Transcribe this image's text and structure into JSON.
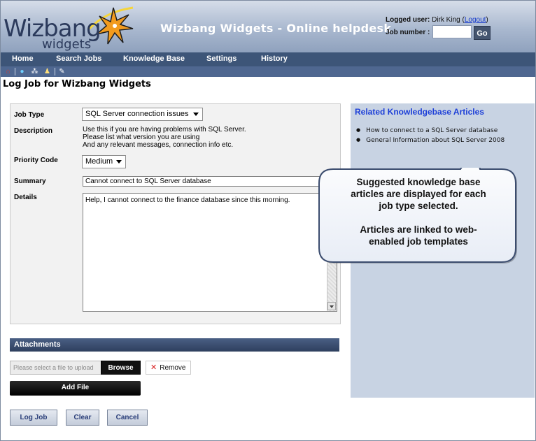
{
  "header": {
    "logo_word": "Wizbang",
    "logo_sub": "widgets",
    "title": "Wizbang Widgets - Online helpdesk",
    "logged_user_label": "Logged user:",
    "logged_user_name": "Dirk King",
    "logout_open": "(",
    "logout_label": "Logout",
    "logout_close": ")",
    "job_number_label": "Job number :",
    "job_number_value": "",
    "go_label": "Go"
  },
  "nav": {
    "items": [
      "Home",
      "Search Jobs",
      "Knowledge Base",
      "Settings",
      "History"
    ]
  },
  "toolbar": {
    "icons": [
      "home-icon",
      "globe-icon",
      "network-icon",
      "users-icon",
      "new-job-icon"
    ]
  },
  "page": {
    "title": "Log Job for Wizbang Widgets"
  },
  "form": {
    "job_type_label": "Job Type",
    "job_type_value": "SQL Server connection issues",
    "description_label": "Description",
    "description_lines": [
      "Use this if you are having problems with SQL Server.",
      "Please list what version you are using",
      "And any relevant messages, connection info etc."
    ],
    "priority_label": "Priority Code",
    "priority_value": "Medium",
    "summary_label": "Summary",
    "summary_value": "Cannot connect to SQL Server database",
    "details_label": "Details",
    "details_value": "Help, I cannot connect to the finance database since this morning."
  },
  "kb": {
    "title": "Related Knowledgebase Articles",
    "articles": [
      "How to connect to a SQL Server database",
      "General Information about SQL Server 2008"
    ]
  },
  "callout": {
    "line1": "Suggested knowledge base",
    "line2": "articles are displayed for each",
    "line3": "job type selected.",
    "line4": "Articles are linked to web-",
    "line5": "enabled job templates"
  },
  "attachments": {
    "header": "Attachments",
    "file_placeholder": "Please select a file to upload",
    "browse_label": "Browse",
    "remove_label": "Remove",
    "add_file_label": "Add File"
  },
  "actions": {
    "log_job": "Log Job",
    "clear": "Clear",
    "cancel": "Cancel"
  },
  "colors": {
    "nav_bg": "#3d5578",
    "kb_panel_bg": "#c8d3e3",
    "kb_title": "#1d3fd8",
    "accent_star": "#f29b1e"
  }
}
